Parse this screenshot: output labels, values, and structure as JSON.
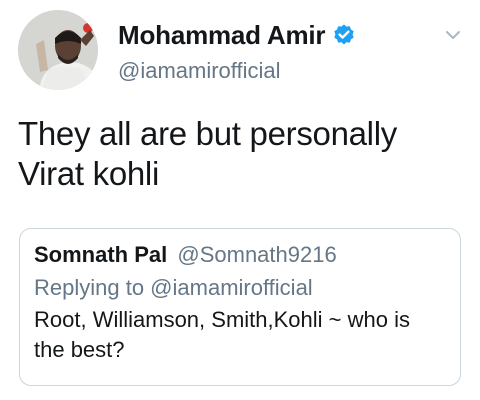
{
  "author": {
    "display_name": "Mohammad Amir",
    "handle": "@iamamirofficial",
    "verified": true
  },
  "tweet": {
    "text": "They all are but personally Virat kohli"
  },
  "quoted_tweet": {
    "display_name": "Somnath Pal",
    "handle": "@Somnath9216",
    "replying_to": "Replying to @iamamirofficial",
    "text": "Root, Williamson, Smith,Kohli ~ who is the best?"
  },
  "colors": {
    "verified_blue": "#1da1f2",
    "secondary_text": "#657786",
    "card_border": "#ccd6dd"
  },
  "icons": {
    "avatar": "avatar",
    "verified": "verified-badge-icon",
    "menu": "chevron-down-icon"
  }
}
